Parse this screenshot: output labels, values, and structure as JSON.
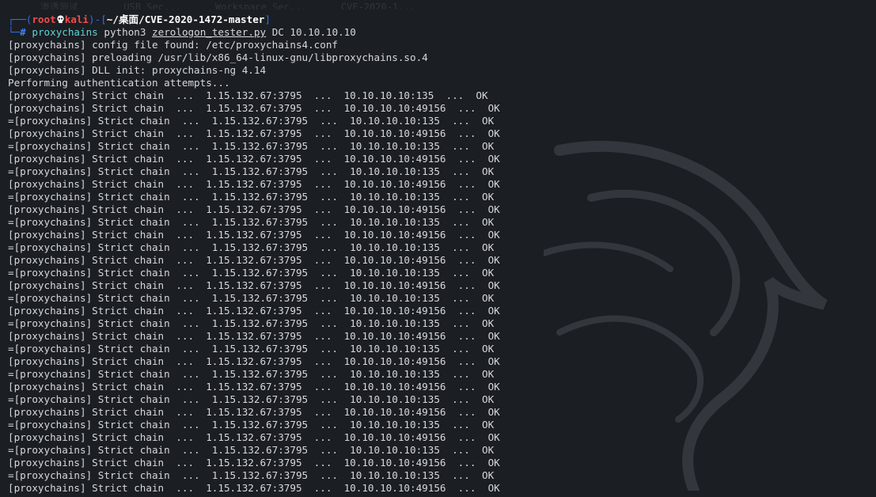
{
  "window": {
    "ghost_bar_text": "       渗透测试        USB Sec...      Workspace Sec...      CVE-2020-1..."
  },
  "prompt": {
    "frame_top_left": "┌──(",
    "user": "root",
    "skull_icon": "skull-icon",
    "host": "kali",
    "frame_mid": ")-[",
    "path": "~/桌面/CVE-2020-1472-master",
    "frame_close": "]",
    "frame_bottom": "└─",
    "hash": "#",
    "command": "proxychains",
    "arg1": "python3",
    "arg2": "zerologon_tester.py",
    "arg3": "DC 10.10.10.10"
  },
  "output": [
    "[proxychains] config file found: /etc/proxychains4.conf",
    "[proxychains] preloading /usr/lib/x86_64-linux-gnu/libproxychains.so.4",
    "[proxychains] DLL init: proxychains-ng 4.14",
    "Performing authentication attempts...",
    "[proxychains] Strict chain  ...  1.15.132.67:3795  ...  10.10.10.10:135  ...  OK",
    "[proxychains] Strict chain  ...  1.15.132.67:3795  ...  10.10.10.10:49156  ...  OK",
    "=[proxychains] Strict chain  ...  1.15.132.67:3795  ...  10.10.10.10:135  ...  OK",
    "[proxychains] Strict chain  ...  1.15.132.67:3795  ...  10.10.10.10:49156  ...  OK",
    "=[proxychains] Strict chain  ...  1.15.132.67:3795  ...  10.10.10.10:135  ...  OK",
    "[proxychains] Strict chain  ...  1.15.132.67:3795  ...  10.10.10.10:49156  ...  OK",
    "=[proxychains] Strict chain  ...  1.15.132.67:3795  ...  10.10.10.10:135  ...  OK",
    "[proxychains] Strict chain  ...  1.15.132.67:3795  ...  10.10.10.10:49156  ...  OK",
    "=[proxychains] Strict chain  ...  1.15.132.67:3795  ...  10.10.10.10:135  ...  OK",
    "[proxychains] Strict chain  ...  1.15.132.67:3795  ...  10.10.10.10:49156  ...  OK",
    "=[proxychains] Strict chain  ...  1.15.132.67:3795  ...  10.10.10.10:135  ...  OK",
    "[proxychains] Strict chain  ...  1.15.132.67:3795  ...  10.10.10.10:49156  ...  OK",
    "=[proxychains] Strict chain  ...  1.15.132.67:3795  ...  10.10.10.10:135  ...  OK",
    "[proxychains] Strict chain  ...  1.15.132.67:3795  ...  10.10.10.10:49156  ...  OK",
    "=[proxychains] Strict chain  ...  1.15.132.67:3795  ...  10.10.10.10:135  ...  OK",
    "[proxychains] Strict chain  ...  1.15.132.67:3795  ...  10.10.10.10:49156  ...  OK",
    "=[proxychains] Strict chain  ...  1.15.132.67:3795  ...  10.10.10.10:135  ...  OK",
    "[proxychains] Strict chain  ...  1.15.132.67:3795  ...  10.10.10.10:49156  ...  OK",
    "=[proxychains] Strict chain  ...  1.15.132.67:3795  ...  10.10.10.10:135  ...  OK",
    "[proxychains] Strict chain  ...  1.15.132.67:3795  ...  10.10.10.10:49156  ...  OK",
    "=[proxychains] Strict chain  ...  1.15.132.67:3795  ...  10.10.10.10:135  ...  OK",
    "[proxychains] Strict chain  ...  1.15.132.67:3795  ...  10.10.10.10:49156  ...  OK",
    "=[proxychains] Strict chain  ...  1.15.132.67:3795  ...  10.10.10.10:135  ...  OK",
    "[proxychains] Strict chain  ...  1.15.132.67:3795  ...  10.10.10.10:49156  ...  OK",
    "=[proxychains] Strict chain  ...  1.15.132.67:3795  ...  10.10.10.10:135  ...  OK",
    "[proxychains] Strict chain  ...  1.15.132.67:3795  ...  10.10.10.10:49156  ...  OK",
    "=[proxychains] Strict chain  ...  1.15.132.67:3795  ...  10.10.10.10:135  ...  OK",
    "[proxychains] Strict chain  ...  1.15.132.67:3795  ...  10.10.10.10:49156  ...  OK",
    "=[proxychains] Strict chain  ...  1.15.132.67:3795  ...  10.10.10.10:135  ...  OK",
    "[proxychains] Strict chain  ...  1.15.132.67:3795  ...  10.10.10.10:49156  ...  OK",
    "=[proxychains] Strict chain  ...  1.15.132.67:3795  ...  10.10.10.10:135  ...  OK",
    "[proxychains] Strict chain  ...  1.15.132.67:3795  ...  10.10.10.10:49156  ...  OK"
  ],
  "colors": {
    "background": "#1b1e23",
    "prompt_frame": "#2f6fe0",
    "prompt_user": "#f24c4c",
    "command": "#5fd3d3",
    "text": "#d6d8dc"
  }
}
